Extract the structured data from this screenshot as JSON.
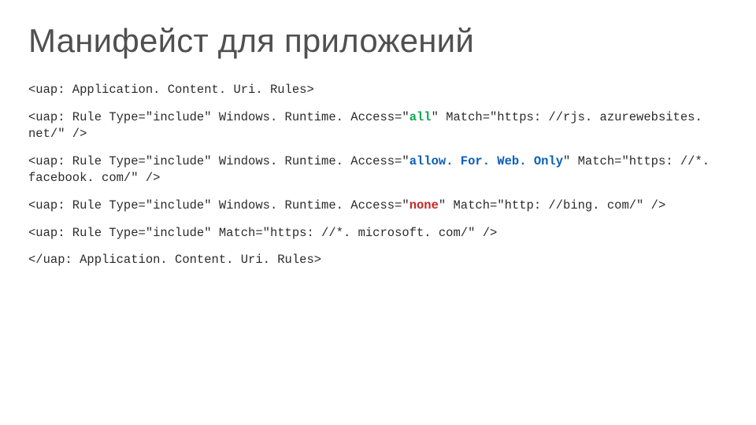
{
  "title": "Манифейст для приложений",
  "code": {
    "open_tag": "<uap: Application. Content. Uri. Rules>",
    "rule1_prefix": "<uap: Rule Type=\"include\" Windows. Runtime. Access=\"",
    "rule1_hl": "all",
    "rule1_suffix": "\" Match=\"https: //rjs. azurewebsites. net/\" />",
    "rule2_prefix": "<uap: Rule Type=\"include\" Windows. Runtime. Access=\"",
    "rule2_hl": "allow. For. Web. Only",
    "rule2_suffix": "\" Match=\"https: //*. facebook. com/\" />",
    "rule3_prefix": "<uap: Rule Type=\"include\" Windows. Runtime. Access=\"",
    "rule3_hl": "none",
    "rule3_suffix": "\" Match=\"http: //bing. com/\" />",
    "rule4": "<uap: Rule Type=\"include\" Match=\"https: //*. microsoft. com/\" />",
    "close_tag": "</uap: Application. Content. Uri. Rules>"
  }
}
